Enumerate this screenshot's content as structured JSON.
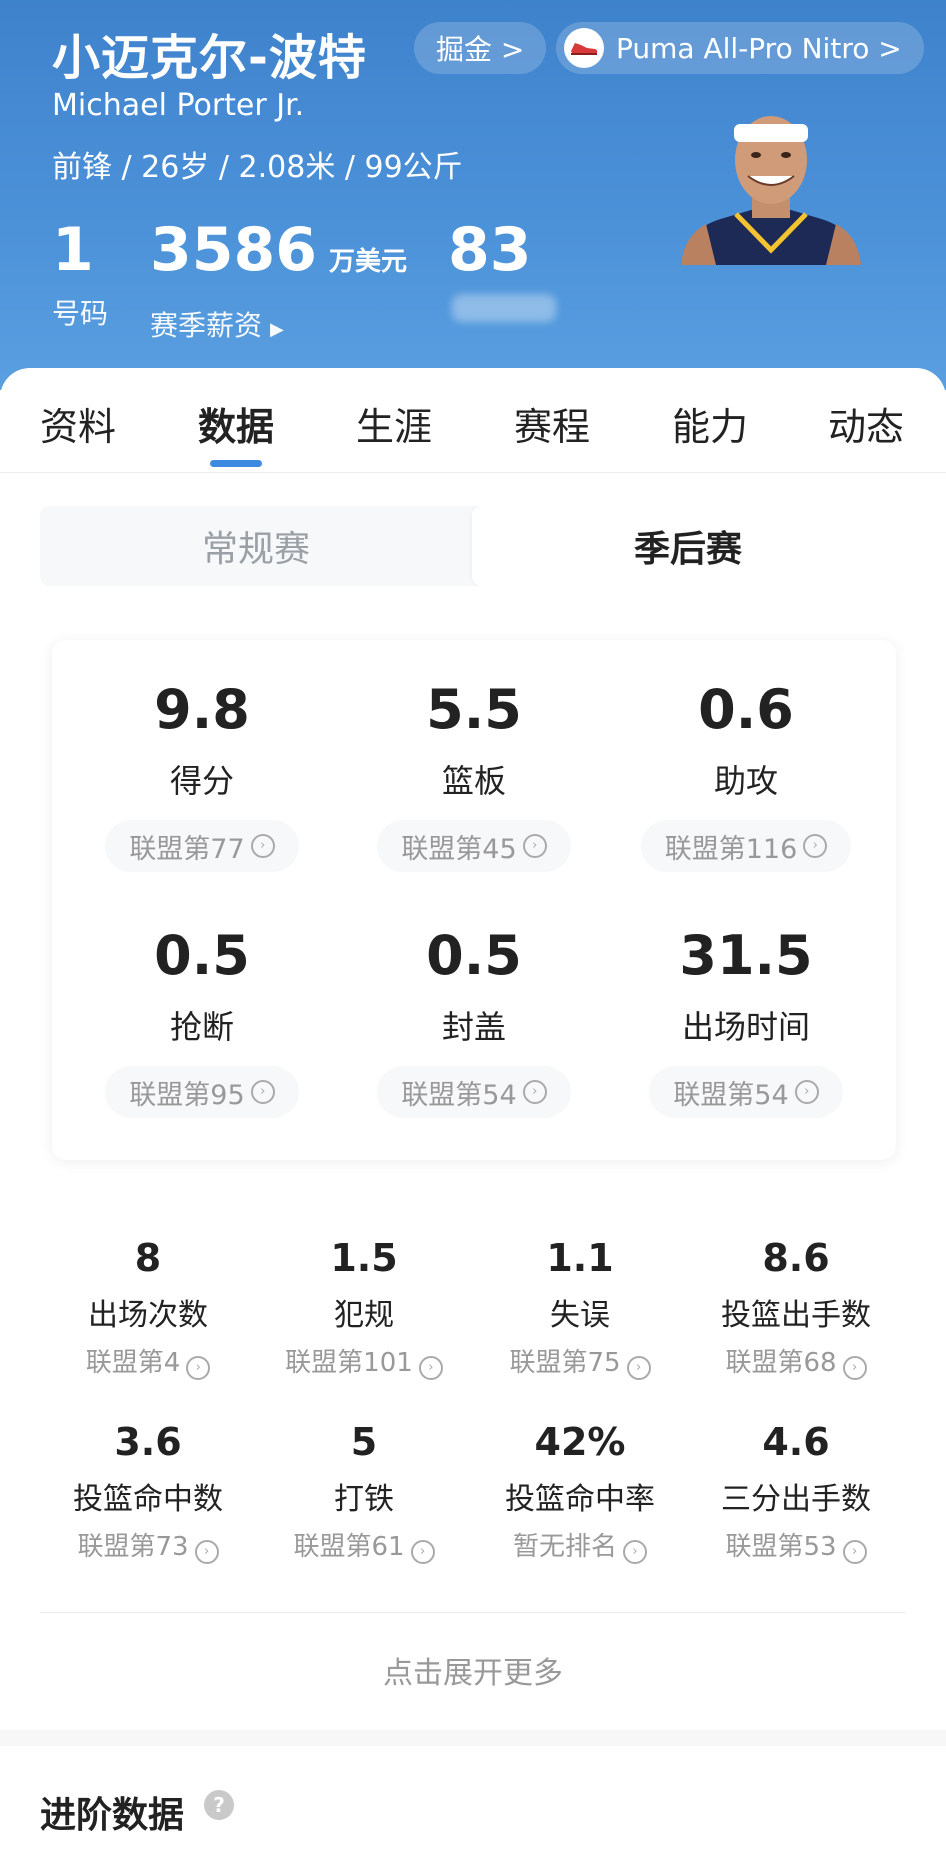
{
  "player": {
    "name_cn": "小迈克尔-波特",
    "name_en": "Michael Porter Jr.",
    "meta": "前锋 / 26岁 / 2.08米 / 99公斤",
    "gold_label": "掘金 >",
    "shoe_label": "Puma All-Pro Nitro >"
  },
  "header_stats": {
    "number_value": "1",
    "number_label": "号码",
    "salary_value": "3586",
    "salary_unit": "万美元",
    "salary_label": "赛季薪资",
    "rating_value": "83"
  },
  "tabs": [
    {
      "label": "资料"
    },
    {
      "label": "数据"
    },
    {
      "label": "生涯"
    },
    {
      "label": "赛程"
    },
    {
      "label": "能力"
    },
    {
      "label": "动态"
    }
  ],
  "active_tab": "数据",
  "segment": {
    "left": "常规赛",
    "right": "季后赛",
    "selected": "季后赛"
  },
  "main_stats": [
    {
      "value": "9.8",
      "label": "得分",
      "rank": "联盟第77"
    },
    {
      "value": "5.5",
      "label": "篮板",
      "rank": "联盟第45"
    },
    {
      "value": "0.6",
      "label": "助攻",
      "rank": "联盟第116"
    },
    {
      "value": "0.5",
      "label": "抢断",
      "rank": "联盟第95"
    },
    {
      "value": "0.5",
      "label": "封盖",
      "rank": "联盟第54"
    },
    {
      "value": "31.5",
      "label": "出场时间",
      "rank": "联盟第54"
    }
  ],
  "grid_stats": [
    {
      "value": "8",
      "label": "出场次数",
      "rank": "联盟第4"
    },
    {
      "value": "1.5",
      "label": "犯规",
      "rank": "联盟第101"
    },
    {
      "value": "1.1",
      "label": "失误",
      "rank": "联盟第75"
    },
    {
      "value": "8.6",
      "label": "投篮出手数",
      "rank": "联盟第68"
    },
    {
      "value": "3.6",
      "label": "投篮命中数",
      "rank": "联盟第73"
    },
    {
      "value": "5",
      "label": "打铁",
      "rank": "联盟第61"
    },
    {
      "value": "42%",
      "label": "投篮命中率",
      "rank": "暂无排名"
    },
    {
      "value": "4.6",
      "label": "三分出手数",
      "rank": "联盟第53"
    }
  ],
  "expand_label": "点击展开更多",
  "advanced_title": "进阶数据",
  "colors": {
    "header_blue": "#4a8fd6",
    "accent": "#3e8ae0",
    "muted": "#999999"
  }
}
